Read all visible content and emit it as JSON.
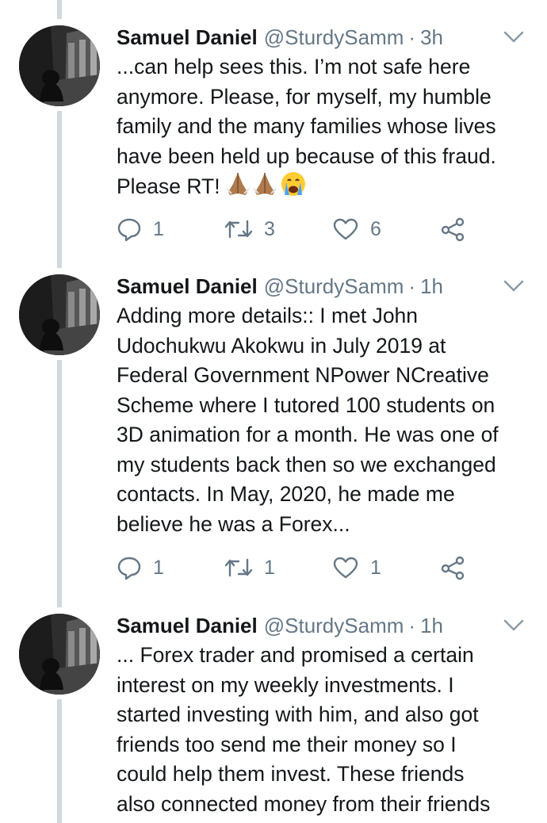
{
  "tweets": [
    {
      "name": "Samuel Daniel",
      "handle": "@SturdySamm",
      "separator": "·",
      "time": "3h",
      "lines": [
        "...can help sees this. I’m not safe here",
        "anymore. Please, for myself, my humble",
        "family and the many families whose lives",
        "have been held up because of this fraud.",
        "Please RT!"
      ],
      "emoji": [
        "folded-hands-emoji",
        "folded-hands-emoji",
        "crying-face-emoji"
      ],
      "replies": "1",
      "retweets": "3",
      "likes": "6"
    },
    {
      "name": "Samuel Daniel",
      "handle": "@SturdySamm",
      "separator": "·",
      "time": "1h",
      "lines": [
        "Adding more details:: I met John",
        "Udochukwu Akokwu in July 2019 at",
        "Federal Government NPower NCreative",
        "Scheme where I tutored 100 students on",
        "3D animation for a month. He was one of",
        "my students back then so we exchanged",
        "contacts. In May, 2020, he made me",
        "believe he was a Forex..."
      ],
      "replies": "1",
      "retweets": "1",
      "likes": "1"
    },
    {
      "name": "Samuel Daniel",
      "handle": "@SturdySamm",
      "separator": "·",
      "time": "1h",
      "lines": [
        "... Forex trader and promised a certain",
        "interest on my weekly investments. I",
        "started investing with him, and also got",
        "friends too send me their money so I",
        "could help them invest. These friends",
        "also connected money from their friends"
      ]
    }
  ],
  "colors": {
    "text": "#14171a",
    "secondary": "#657786",
    "thread_line": "#cfd9de",
    "icon": "#657786"
  },
  "icons": {
    "reply": "reply-icon",
    "retweet": "retweet-icon",
    "like": "heart-icon",
    "share": "share-icon",
    "menu": "chevron-down-icon"
  }
}
